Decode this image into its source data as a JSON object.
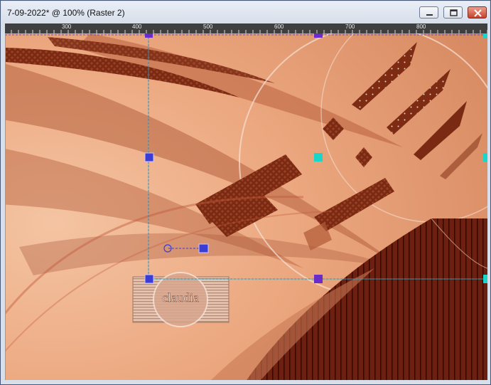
{
  "window": {
    "title": "7-09-2022* @ 100% (Raster 2)",
    "buttons": [
      "minimize",
      "maximize",
      "close"
    ]
  },
  "ruler": {
    "labels": [
      "300",
      "400",
      "500",
      "600",
      "700",
      "800"
    ]
  },
  "colors": {
    "canvas_light": "#f2b08c",
    "canvas_mid": "#d98c68",
    "pattern_dark": "#7a2a12",
    "guide_blue": "#3b3bd6",
    "handle_cyan": "#19d6c8",
    "handle_purple": "#6a2bc8",
    "ruler_bg": "#3f3f3f"
  },
  "canvas": {
    "watermark_text": "claudia"
  },
  "icons": [
    "minimize-icon",
    "maximize-icon",
    "close-icon",
    "pick-tool-handle-icon",
    "rotation-pivot-icon"
  ]
}
